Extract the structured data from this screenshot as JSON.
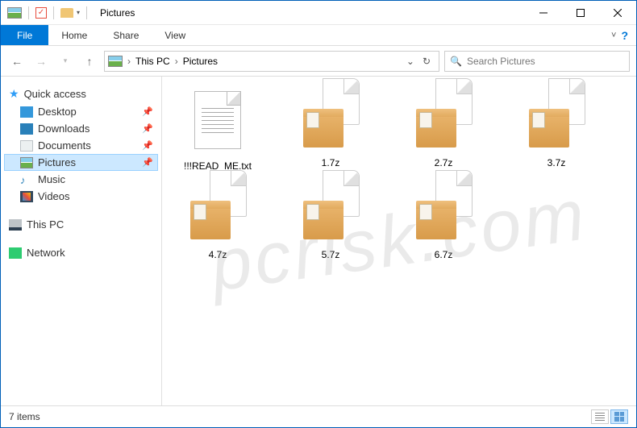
{
  "window": {
    "title": "Pictures"
  },
  "ribbon": {
    "file": "File",
    "tabs": [
      "Home",
      "Share",
      "View"
    ]
  },
  "breadcrumb": {
    "root": "This PC",
    "current": "Pictures"
  },
  "search": {
    "placeholder": "Search Pictures"
  },
  "sidebar": {
    "quick_access": "Quick access",
    "items": [
      {
        "label": "Desktop",
        "icon": "desktop",
        "pinned": true
      },
      {
        "label": "Downloads",
        "icon": "downloads",
        "pinned": true
      },
      {
        "label": "Documents",
        "icon": "documents",
        "pinned": true
      },
      {
        "label": "Pictures",
        "icon": "pictures",
        "pinned": true,
        "selected": true
      },
      {
        "label": "Music",
        "icon": "music",
        "pinned": false
      },
      {
        "label": "Videos",
        "icon": "videos",
        "pinned": false
      }
    ],
    "this_pc": "This PC",
    "network": "Network"
  },
  "files": [
    {
      "name": "!!!READ_ME.txt",
      "type": "txt"
    },
    {
      "name": "1.7z",
      "type": "archive"
    },
    {
      "name": "2.7z",
      "type": "archive"
    },
    {
      "name": "3.7z",
      "type": "archive"
    },
    {
      "name": "4.7z",
      "type": "archive"
    },
    {
      "name": "5.7z",
      "type": "archive"
    },
    {
      "name": "6.7z",
      "type": "archive"
    }
  ],
  "status": {
    "count": "7 items"
  },
  "watermark": "pcrisk.com"
}
